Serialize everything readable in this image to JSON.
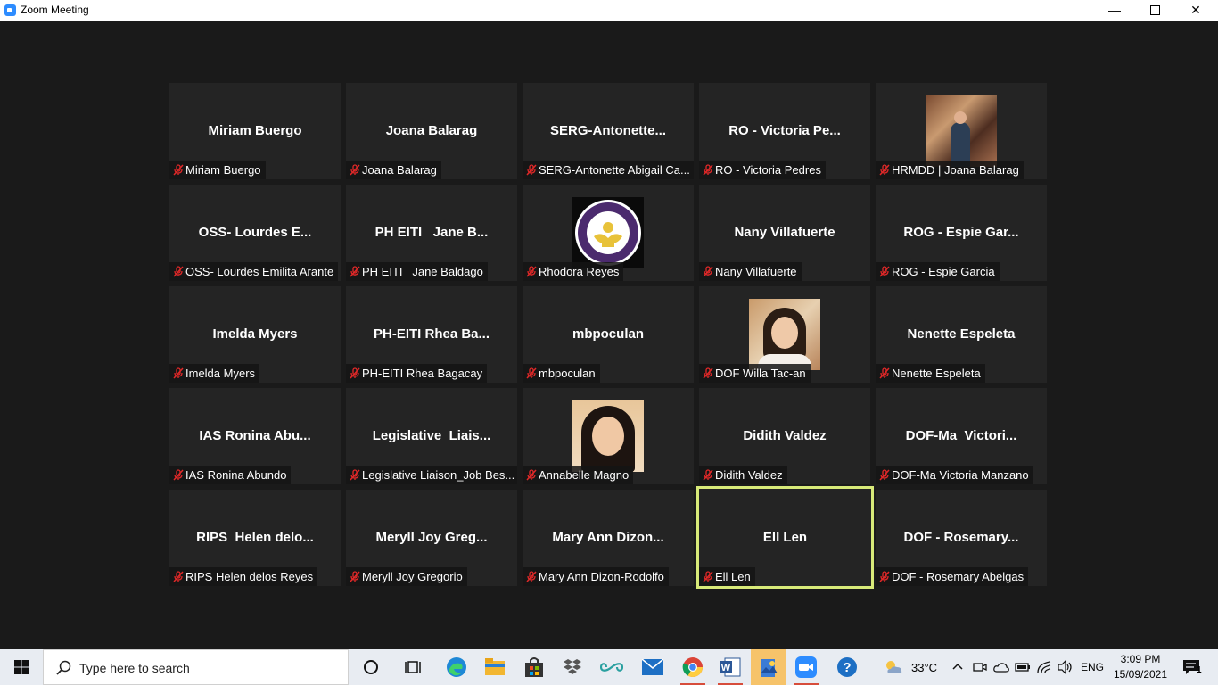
{
  "window": {
    "title": "Zoom Meeting",
    "minimize": "—",
    "close": "✕"
  },
  "participants": [
    {
      "display": "Miriam Buergo",
      "name": "Miriam Buergo"
    },
    {
      "display": "Joana Balarag",
      "name": "Joana Balarag"
    },
    {
      "display": "SERG-Antonette...",
      "name": "SERG-Antonette Abigail Ca..."
    },
    {
      "display": "RO - Victoria Pe...",
      "name": "RO - Victoria Pedres"
    },
    {
      "display": "",
      "name": "HRMDD | Joana Balarag"
    },
    {
      "display": "OSS- Lourdes E...",
      "name": "OSS- Lourdes Emilita Arante"
    },
    {
      "display": "PH EITI   Jane B...",
      "name": "PH EITI   Jane Baldago"
    },
    {
      "display": "",
      "name": "Rhodora Reyes"
    },
    {
      "display": "Nany Villafuerte",
      "name": "Nany Villafuerte"
    },
    {
      "display": "ROG - Espie Gar...",
      "name": "ROG - Espie Garcia"
    },
    {
      "display": "Imelda Myers",
      "name": "Imelda Myers"
    },
    {
      "display": "PH-EITI Rhea Ba...",
      "name": "PH-EITI Rhea Bagacay"
    },
    {
      "display": "mbpoculan",
      "name": "mbpoculan"
    },
    {
      "display": "",
      "name": "DOF Willa Tac-an"
    },
    {
      "display": "Nenette Espeleta",
      "name": "Nenette Espeleta"
    },
    {
      "display": "IAS Ronina Abu...",
      "name": "IAS Ronina Abundo"
    },
    {
      "display": "Legislative  Liais...",
      "name": "Legislative Liaison_Job Bes..."
    },
    {
      "display": "",
      "name": "Annabelle Magno"
    },
    {
      "display": "Didith Valdez",
      "name": "Didith Valdez"
    },
    {
      "display": "DOF-Ma  Victori...",
      "name": "DOF-Ma Victoria Manzano"
    },
    {
      "display": "RIPS  Helen delo...",
      "name": "RIPS Helen delos Reyes"
    },
    {
      "display": "Meryll Joy Greg...",
      "name": "Meryll Joy Gregorio"
    },
    {
      "display": "Mary Ann Dizon...",
      "name": "Mary Ann Dizon-Rodolfo"
    },
    {
      "display": "Ell Len",
      "name": "Ell Len"
    },
    {
      "display": "DOF - Rosemary...",
      "name": "DOF - Rosemary Abelgas"
    }
  ],
  "colors": {
    "active_speaker": "#d8ea79",
    "mute": "#e02828",
    "tile_bg": "#242424"
  },
  "taskbar": {
    "search_placeholder": "Type here to search",
    "weather": "33°C",
    "language": "ENG",
    "time": "3:09 PM",
    "date": "15/09/2021",
    "notifications": "1"
  }
}
